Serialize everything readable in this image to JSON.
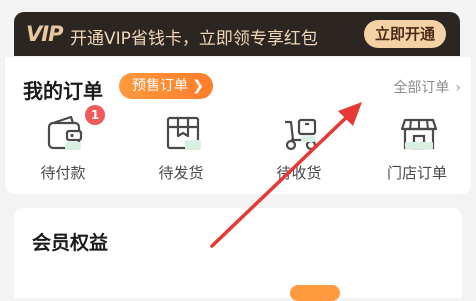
{
  "vip_banner": {
    "logo": "VIP",
    "text": "开通VIP省钱卡，立即领专享红包",
    "button": "立即开通",
    "colors": {
      "background": "#2b2622",
      "text": "#f1d6b7",
      "button": "#f4d2a6"
    }
  },
  "orders": {
    "title": "我的订单",
    "presale_tag": "预售订单",
    "all_orders": "全部订单",
    "items": [
      {
        "label": "待付款",
        "icon": "wallet-icon",
        "badge": "1"
      },
      {
        "label": "待发货",
        "icon": "box-icon"
      },
      {
        "label": "待收货",
        "icon": "delivery-scooter-icon"
      },
      {
        "label": "门店订单",
        "icon": "store-icon"
      }
    ]
  },
  "member": {
    "title": "会员权益"
  },
  "annotation": {
    "type": "red-arrow",
    "target": "all-orders-link",
    "color": "#e53935"
  }
}
